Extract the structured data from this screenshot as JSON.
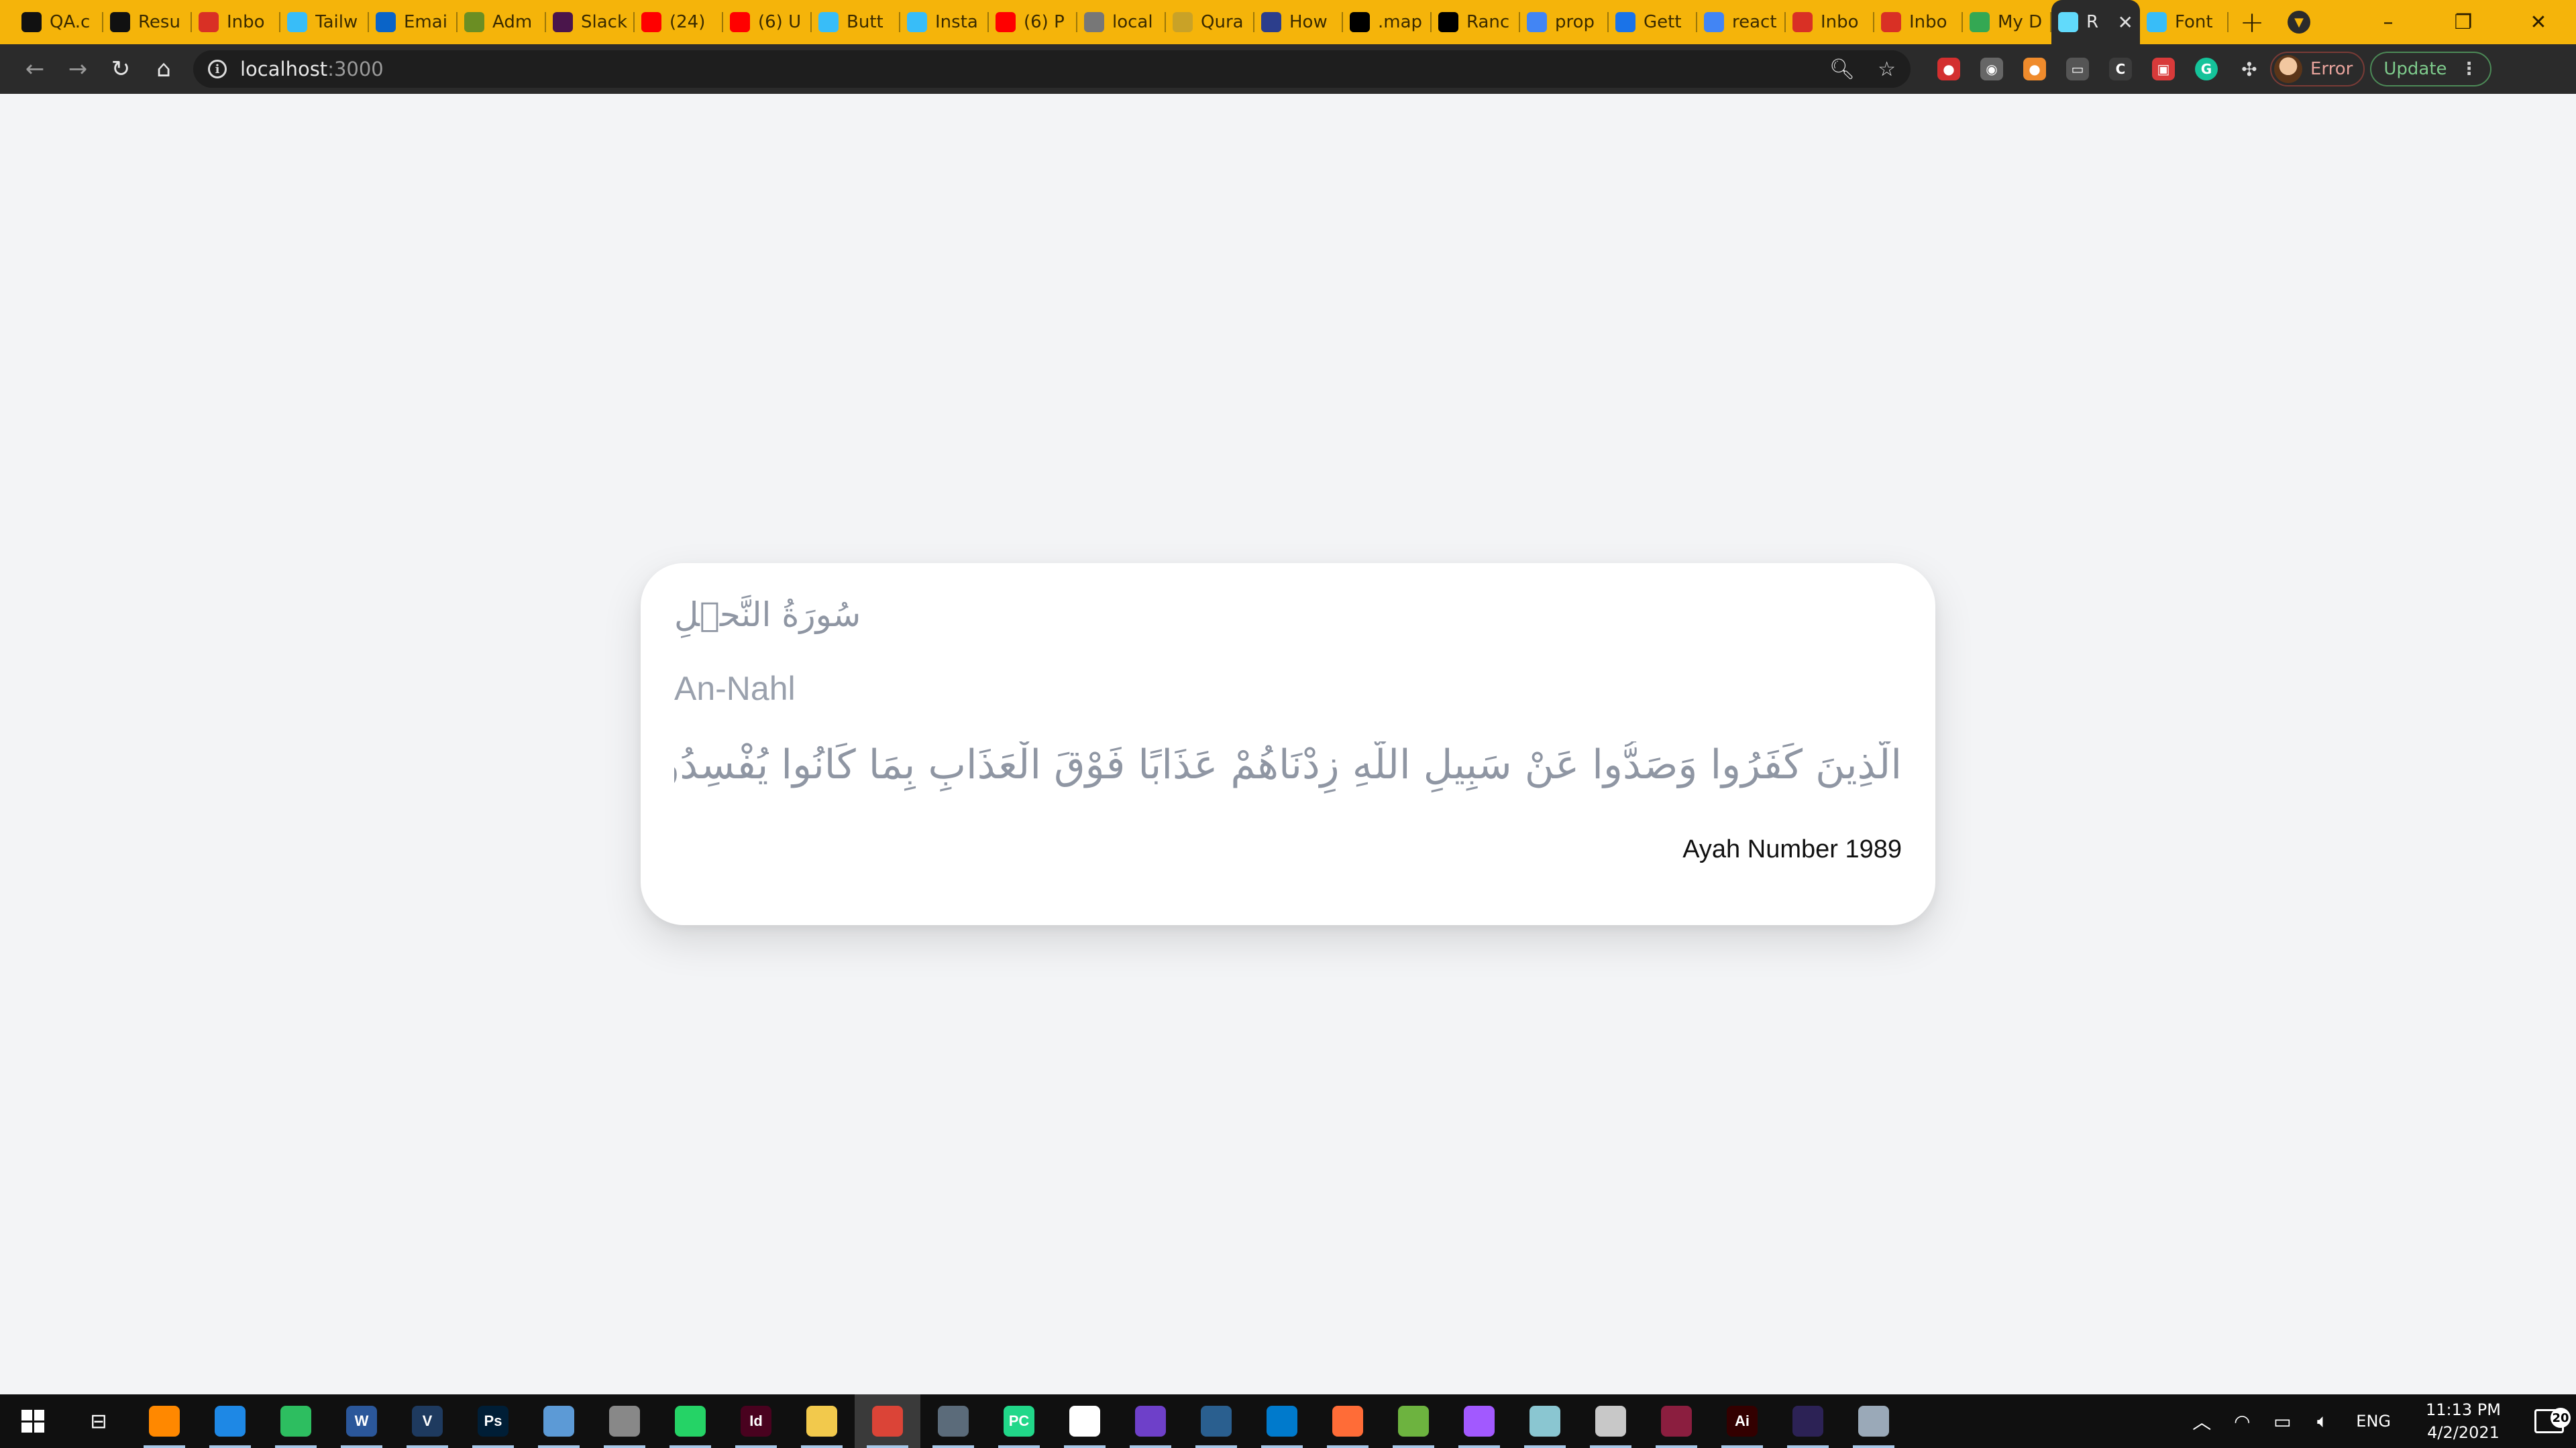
{
  "browser": {
    "tabs": [
      {
        "title": "QA.c",
        "icon": "qa-icon",
        "color": "#111111"
      },
      {
        "title": "Resu",
        "icon": "qa-icon",
        "color": "#111111"
      },
      {
        "title": "Inbo",
        "icon": "gmail-icon",
        "color": "#d93025"
      },
      {
        "title": "Tailw",
        "icon": "tailwind-icon",
        "color": "#38bdf8"
      },
      {
        "title": "Emai",
        "icon": "outlook-icon",
        "color": "#0a64c8"
      },
      {
        "title": "Adm",
        "icon": "admin-icon",
        "color": "#6b8e23"
      },
      {
        "title": "Slack",
        "icon": "slack-icon",
        "color": "#4a154b"
      },
      {
        "title": "(24)",
        "icon": "youtube-icon",
        "color": "#ff0000"
      },
      {
        "title": "(6) U",
        "icon": "youtube-icon",
        "color": "#ff0000"
      },
      {
        "title": "Butt",
        "icon": "tailwind-icon",
        "color": "#38bdf8"
      },
      {
        "title": "Insta",
        "icon": "tailwind-icon",
        "color": "#38bdf8"
      },
      {
        "title": "(6) P",
        "icon": "youtube-icon",
        "color": "#ff0000"
      },
      {
        "title": "local",
        "icon": "globe-icon",
        "color": "#777777"
      },
      {
        "title": "Qura",
        "icon": "quran-icon",
        "color": "#c9a227"
      },
      {
        "title": "How",
        "icon": "how-icon",
        "color": "#2c3e8c"
      },
      {
        "title": ".map",
        "icon": "a-icon",
        "color": "#000000"
      },
      {
        "title": "Ranc",
        "icon": "codesandbox-icon",
        "color": "#000000"
      },
      {
        "title": "prop",
        "icon": "google-icon",
        "color": "#4285f4"
      },
      {
        "title": "Gett",
        "icon": "video-icon",
        "color": "#1a73e8"
      },
      {
        "title": "react",
        "icon": "google-icon",
        "color": "#4285f4"
      },
      {
        "title": "Inbo",
        "icon": "gmail-icon",
        "color": "#d93025"
      },
      {
        "title": "Inbo",
        "icon": "gmail-icon",
        "color": "#d93025"
      },
      {
        "title": "My D",
        "icon": "drive-icon",
        "color": "#34a853"
      },
      {
        "title": "R",
        "icon": "react-icon",
        "color": "#61dafb",
        "active": true
      },
      {
        "title": "Font",
        "icon": "tailwind-icon",
        "color": "#38bdf8"
      }
    ],
    "new_tab_label": "+",
    "address": {
      "host": "localhost",
      "port": ":3000"
    },
    "profile_label": "Error",
    "update_label": "Update"
  },
  "page": {
    "surah_name_arabic": "سُورَةُ النَّحۡلِ",
    "surah_name_english": "An-Nahl",
    "ayah_text": "الَّذِينَ كَفَرُوا وَصَدُّوا عَنْ سَبِيلِ اللَّهِ زِدْنَاهُمْ عَذَابًا فَوْقَ الْعَذَابِ بِمَا كَانُوا يُفْسِدُونَ",
    "ayah_number_label": "Ayah Number 1989"
  },
  "taskbar": {
    "apps": [
      {
        "name": "vlc-icon",
        "label": "",
        "color": "#ff8800"
      },
      {
        "name": "calendar-icon",
        "label": "",
        "color": "#1e88e5"
      },
      {
        "name": "evernote-icon",
        "label": "",
        "color": "#2dbe60"
      },
      {
        "name": "word-icon",
        "label": "W",
        "color": "#2b579a"
      },
      {
        "name": "vim-icon",
        "label": "V",
        "color": "#1e3a5f"
      },
      {
        "name": "photoshop-icon",
        "label": "Ps",
        "color": "#001e36"
      },
      {
        "name": "vs-icon",
        "label": "",
        "color": "#5c9ad6"
      },
      {
        "name": "paint-icon",
        "label": "",
        "color": "#888888"
      },
      {
        "name": "whatsapp-icon",
        "label": "",
        "color": "#25d366"
      },
      {
        "name": "indesign-icon",
        "label": "Id",
        "color": "#49021f"
      },
      {
        "name": "file-explorer-icon",
        "label": "",
        "color": "#f2c94c"
      },
      {
        "name": "chrome-icon",
        "label": "",
        "color": "#db4437",
        "active": true
      },
      {
        "name": "calculator-icon",
        "label": "",
        "color": "#5b6b7a"
      },
      {
        "name": "pycharm-icon",
        "label": "PC",
        "color": "#21d789"
      },
      {
        "name": "file-icon",
        "label": "",
        "color": "#ffffff"
      },
      {
        "name": "github-icon",
        "label": "",
        "color": "#6e40c9"
      },
      {
        "name": "sql-icon",
        "label": "",
        "color": "#2a5f8f"
      },
      {
        "name": "vscode-icon",
        "label": "",
        "color": "#007acc"
      },
      {
        "name": "postman-icon",
        "label": "",
        "color": "#ff6c37"
      },
      {
        "name": "spring-icon",
        "label": "",
        "color": "#6db33f"
      },
      {
        "name": "figma-icon",
        "label": "",
        "color": "#a259ff"
      },
      {
        "name": "notes-icon",
        "label": "",
        "color": "#8ac6d1"
      },
      {
        "name": "paint3d-icon",
        "label": "",
        "color": "#c8c8c8"
      },
      {
        "name": "winrar-icon",
        "label": "",
        "color": "#8b1e3f"
      },
      {
        "name": "illustrator-icon",
        "label": "Ai",
        "color": "#330000"
      },
      {
        "name": "eclipse-icon",
        "label": "",
        "color": "#2c2255"
      },
      {
        "name": "network-icon",
        "label": "",
        "color": "#9aa9b8"
      }
    ],
    "language": "ENG",
    "time": "11:13 PM",
    "date": "4/2/2021",
    "notification_count": "20"
  }
}
